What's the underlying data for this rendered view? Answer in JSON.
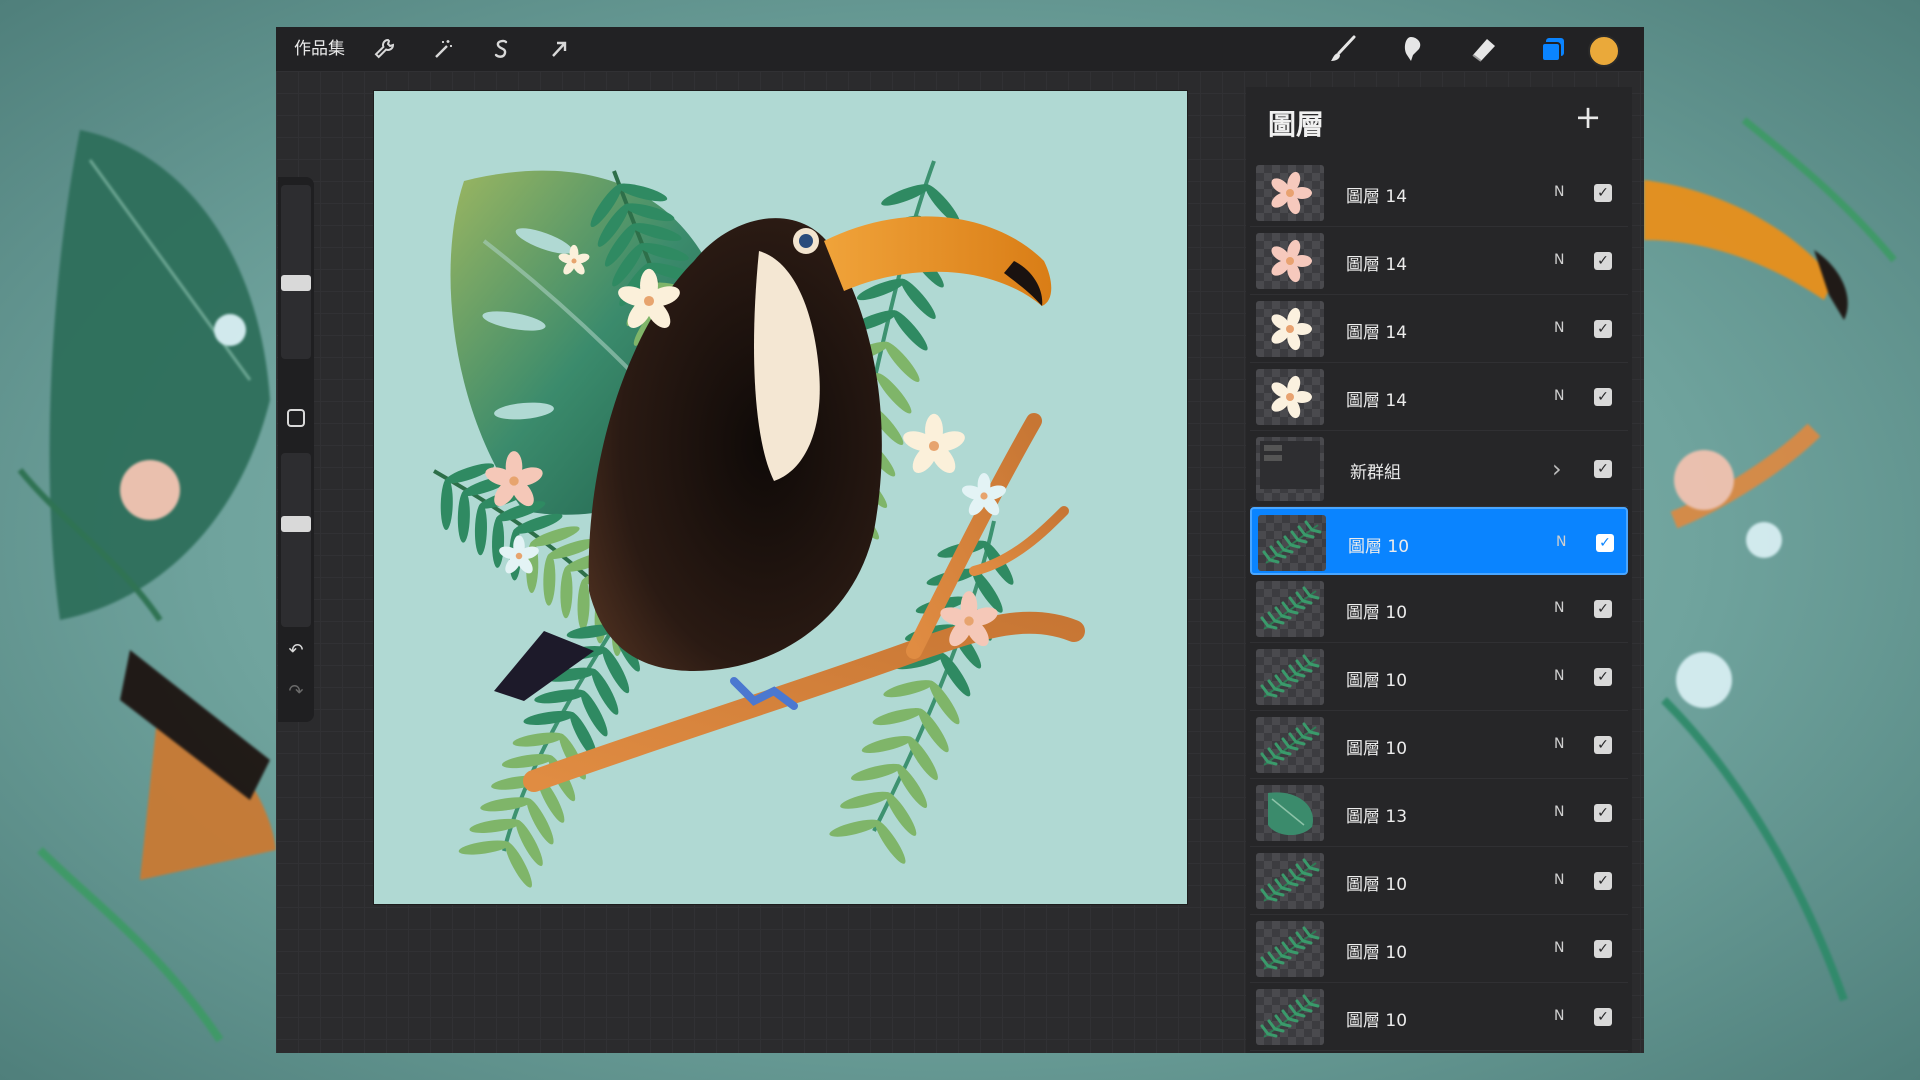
{
  "topbar": {
    "gallery_label": "作品集",
    "left_tools": [
      {
        "name": "actions",
        "icon": "wrench-icon",
        "glyph": "🔧"
      },
      {
        "name": "adjustments",
        "icon": "magic-wand-icon",
        "glyph": "✎"
      },
      {
        "name": "selection",
        "icon": "selection-icon",
        "glyph": "S"
      },
      {
        "name": "transform",
        "icon": "arrow-cursor-icon",
        "glyph": "➚"
      }
    ],
    "right_tools": [
      {
        "name": "brush",
        "icon": "brush-icon"
      },
      {
        "name": "smudge",
        "icon": "smudge-icon"
      },
      {
        "name": "eraser",
        "icon": "eraser-icon"
      },
      {
        "name": "layers",
        "icon": "layers-icon"
      }
    ],
    "current_color": "#eaa93a"
  },
  "sidebar": {
    "brush_size_level": 0.43,
    "opacity_level": 0.6
  },
  "layers": {
    "title": "圖層",
    "add_glyph": "+",
    "items": [
      {
        "name": "圖層 14",
        "blend": "N",
        "visible": true,
        "thumb": "flower-pink"
      },
      {
        "name": "圖層 14",
        "blend": "N",
        "visible": true,
        "thumb": "flower-pink"
      },
      {
        "name": "圖層 14",
        "blend": "N",
        "visible": true,
        "thumb": "flower-white"
      },
      {
        "name": "圖層 14",
        "blend": "N",
        "visible": true,
        "thumb": "flower-white"
      },
      {
        "name": "新群組",
        "blend": "",
        "visible": true,
        "thumb": "group",
        "group": true
      },
      {
        "name": "圖層 10",
        "blend": "N",
        "visible": true,
        "thumb": "fern",
        "selected": true
      },
      {
        "name": "圖層 10",
        "blend": "N",
        "visible": true,
        "thumb": "fern"
      },
      {
        "name": "圖層 10",
        "blend": "N",
        "visible": true,
        "thumb": "fern"
      },
      {
        "name": "圖層 10",
        "blend": "N",
        "visible": true,
        "thumb": "fern"
      },
      {
        "name": "圖層 13",
        "blend": "N",
        "visible": true,
        "thumb": "monstera"
      },
      {
        "name": "圖層 10",
        "blend": "N",
        "visible": true,
        "thumb": "fern"
      },
      {
        "name": "圖層 10",
        "blend": "N",
        "visible": true,
        "thumb": "fern"
      },
      {
        "name": "圖層 10",
        "blend": "N",
        "visible": true,
        "thumb": "fern"
      }
    ]
  },
  "colors": {
    "accent": "#0a84ff",
    "canvas_bg": "#b0d9d3",
    "beak": "#e8901c",
    "body": "#2a1a14",
    "leaf": "#2f8a6a",
    "branch": "#d98a45"
  }
}
